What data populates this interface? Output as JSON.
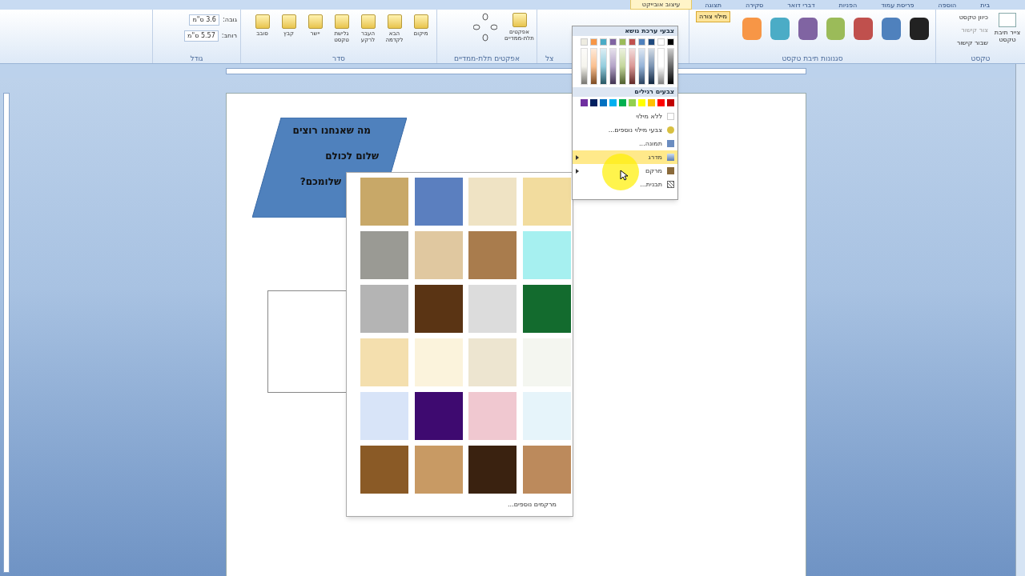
{
  "tabs": [
    {
      "label": "בית",
      "selected": false
    },
    {
      "label": "הוספה",
      "selected": false
    },
    {
      "label": "פריסת עמוד",
      "selected": false
    },
    {
      "label": "הפניות",
      "selected": false
    },
    {
      "label": "דברי דואר",
      "selected": false
    },
    {
      "label": "סקירה",
      "selected": false
    },
    {
      "label": "תצוגה",
      "selected": false
    },
    {
      "label": "עיצוב אובייקט",
      "selected": true
    }
  ],
  "ribbon": {
    "text_group": {
      "label": "טקסט",
      "draw_button": "צייר תיבת טקסט",
      "direction": "כיוון טקסט",
      "create_link": "צור קישור",
      "break_link": "שבור קישור"
    },
    "styles_group": {
      "label": "סגנונות תיבת טקסט",
      "fill_button": "מילוי צורה",
      "styles": [
        {
          "color": "#222222"
        },
        {
          "color": "#4f81bd"
        },
        {
          "color": "#c0504d"
        },
        {
          "color": "#9bbb59"
        },
        {
          "color": "#8064a2"
        },
        {
          "color": "#4bacc6"
        },
        {
          "color": "#f79646"
        }
      ]
    },
    "shadow_group": {
      "label": "צל"
    },
    "effects_group": {
      "label": "אפקטים תלת-ממדיים",
      "button": "אפקטים תלת-ממדיים"
    },
    "arrange_group": {
      "label": "סדר",
      "buttons": [
        "מיקום",
        "הבא לקדמה",
        "העבר לרקע",
        "גלישת טקסט",
        "יישר",
        "קבץ",
        "סובב"
      ]
    },
    "size_group": {
      "label": "גודל",
      "height_label": "גובה:",
      "height": "3.6 ס\"מ",
      "width_label": "רוחב:",
      "width": "5.57 ס\"מ"
    }
  },
  "document": {
    "shape_lines": [
      "מה שאנחנו רוצים",
      "שלום לכולם",
      "שלומכם?"
    ]
  },
  "fill_menu": {
    "theme_title": "צבעי ערכת נושא",
    "theme_colors": [
      {
        "color": "#000000"
      },
      {
        "color": "#ffffff"
      },
      {
        "color": "#1f497d"
      },
      {
        "color": "#4f81bd"
      },
      {
        "color": "#c0504d"
      },
      {
        "color": "#9bbb59"
      },
      {
        "color": "#8064a2"
      },
      {
        "color": "#4bacc6"
      },
      {
        "color": "#f79646"
      },
      {
        "color": "#eeece1"
      }
    ],
    "standard_title": "צבעים רגילים",
    "standard_colors": [
      {
        "color": "#c00000"
      },
      {
        "color": "#ff0000"
      },
      {
        "color": "#ffc000"
      },
      {
        "color": "#ffff00"
      },
      {
        "color": "#92d050"
      },
      {
        "color": "#00b050"
      },
      {
        "color": "#00b0f0"
      },
      {
        "color": "#0070c0"
      },
      {
        "color": "#002060"
      },
      {
        "color": "#7030a0"
      }
    ],
    "items": [
      {
        "label": "ללא מילוי",
        "kind": "none",
        "selected": false,
        "submenu": false
      },
      {
        "label": "צבעי מילוי נוספים...",
        "kind": "palette",
        "selected": false,
        "submenu": false
      },
      {
        "label": "תמונה...",
        "kind": "picture",
        "selected": false,
        "submenu": false
      },
      {
        "label": "מדרג",
        "kind": "gradient",
        "selected": true,
        "submenu": true
      },
      {
        "label": "מרקם",
        "kind": "texture",
        "selected": false,
        "submenu": true
      },
      {
        "label": "תבנית...",
        "kind": "pattern",
        "selected": false,
        "submenu": false
      }
    ]
  },
  "texture_gallery": {
    "textures": [
      {
        "color": "#f2dc9e"
      },
      {
        "color": "#efe3c4"
      },
      {
        "color": "#5b7fbf"
      },
      {
        "color": "#c8a868"
      },
      {
        "color": "#a6f0f0"
      },
      {
        "color": "#a97c4d"
      },
      {
        "color": "#e0c8a0"
      },
      {
        "color": "#9a9a94"
      },
      {
        "color": "#136b2e"
      },
      {
        "color": "#dcdcdc"
      },
      {
        "color": "#5a3414"
      },
      {
        "color": "#b4b4b4"
      },
      {
        "color": "#f4f6f0"
      },
      {
        "color": "#ede5d0"
      },
      {
        "color": "#fbf3dc"
      },
      {
        "color": "#f4dfae"
      },
      {
        "color": "#e6f4fa"
      },
      {
        "color": "#f0c8d0"
      },
      {
        "color": "#3e0a70"
      },
      {
        "color": "#d8e4f8"
      },
      {
        "color": "#bc8a5c"
      },
      {
        "color": "#3a2210"
      },
      {
        "color": "#c89a64"
      },
      {
        "color": "#8a5a26"
      }
    ],
    "more": "מרקמים נוספים..."
  }
}
